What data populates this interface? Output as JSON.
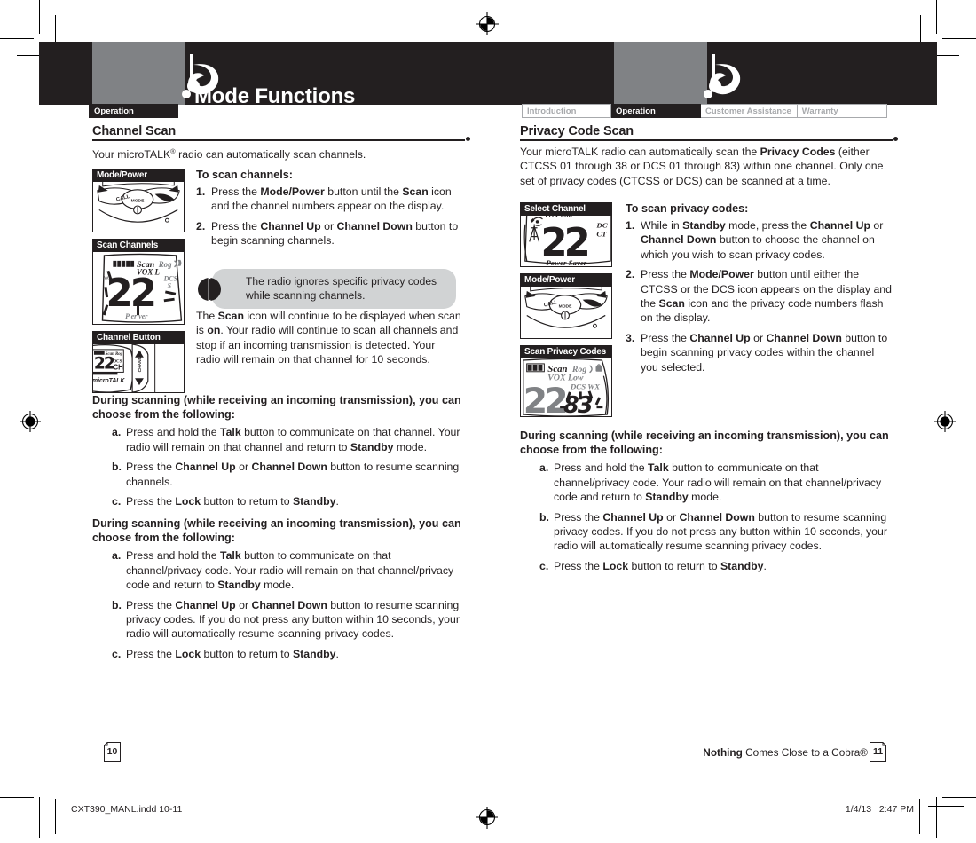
{
  "document": {
    "page_title": "Mode Functions",
    "tabs_left": [
      {
        "label": "Operation",
        "active": true
      }
    ],
    "tabs_right": [
      {
        "label": "Introduction",
        "active": false
      },
      {
        "label": "Operation",
        "active": true
      },
      {
        "label": "Customer Assistance",
        "active": false
      },
      {
        "label": "Warranty",
        "active": false
      }
    ],
    "colors": {
      "ink": "#231f20",
      "header_gray": "#808285",
      "note_gray": "#d1d3d4",
      "tab_inactive": "#a7a9ac"
    }
  },
  "left_page": {
    "page_number": "10",
    "section": {
      "title": "Channel Scan",
      "intro_html": "Your microTALK<sup>®</sup> radio can automatically scan channels."
    },
    "figures": [
      {
        "caption": "Mode/Power",
        "icon": "radio-keypad-photo"
      },
      {
        "caption": "Scan Channels",
        "icon": "lcd-display-scan-channels",
        "lcd": {
          "bars": 5,
          "labels_top": "Scan Rog",
          "labels_sub": "VOX L",
          "digits": "22",
          "labels_right": "DCS",
          "labels_bottom": "Power Saver"
        }
      },
      {
        "caption": "Channel Button",
        "icon": "radio-side-channel-button",
        "lcd": {
          "digits": "22",
          "unit": "CH"
        },
        "side_label": "CHANNEL"
      }
    ],
    "instructions": {
      "heading": "To scan channels:",
      "steps": [
        {
          "num": "1.",
          "html": "Press the <b>Mode/Power</b> button until the <b>Scan</b> icon and the channel numbers appear on the display."
        },
        {
          "num": "2.",
          "html": "Press the <b>Channel Up</b> or <b>Channel Down</b> button to begin scanning channels."
        }
      ]
    },
    "note": {
      "icon": "info-circle-icon",
      "text": "The radio ignores specific privacy codes while scanning channels."
    },
    "body_paragraph_html": "The <b>Scan</b> icon will continue to be displayed when scan is <b>on</b>. Your radio will continue to scan all channels and stop if an incoming transmission is detected. Your radio will remain on that channel for 10 seconds.",
    "blocks": [
      {
        "heading": "During scanning (while receiving an incoming transmission), you can choose from the following:",
        "items": [
          {
            "ltr": "a.",
            "html": "Press and hold the <b>Talk</b> button to communicate on that channel. Your radio will remain on that channel and return to <b>Standby</b> mode."
          },
          {
            "ltr": "b.",
            "html": "Press the <b>Channel Up</b> or <b>Channel Down</b> button to resume scanning channels."
          },
          {
            "ltr": "c.",
            "html": "Press the <b>Lock</b> button to return to <b>Standby</b>."
          }
        ]
      },
      {
        "heading": "During scanning (while receiving an incoming transmission), you can choose from the following:",
        "items": [
          {
            "ltr": "a.",
            "html": "Press and hold the <b>Talk</b> button to communicate on that channel/privacy code. Your radio will remain on that channel/privacy code and return to <b>Standby</b> mode."
          },
          {
            "ltr": "b.",
            "html": "Press the <b>Channel Up</b> or <b>Channel Down</b> button to resume scanning privacy codes. If you do not press any button within 10 seconds, your radio will automatically resume scanning privacy codes."
          },
          {
            "ltr": "c.",
            "html": "Press the <b>Lock</b> button to return to <b>Standby</b>."
          }
        ]
      }
    ]
  },
  "right_page": {
    "page_number": "11",
    "section": {
      "title": "Privacy Code Scan",
      "intro_html": "Your microTALK radio can automatically scan the <b>Privacy Codes</b> (either CTCSS 01 through 38 or DCS 01 through 83) within one channel. Only one set of privacy codes (CTCSS or DCS) can be scanned at a time."
    },
    "figures": [
      {
        "caption": "Select Channel",
        "icon": "lcd-display-select-channel",
        "lcd": {
          "digits": "22",
          "labels_right_top": "DCS",
          "labels_right_bottom": "CTCSS",
          "labels_bottom": "Power Saver"
        }
      },
      {
        "caption": "Mode/Power",
        "icon": "radio-keypad-photo"
      },
      {
        "caption": "Scan Privacy Codes",
        "icon": "lcd-display-scan-privacy-codes",
        "lcd": {
          "bars": 3,
          "labels_top": "Scan Rog",
          "labels_sub": "VOX Low",
          "digits": "22",
          "code": "83",
          "labels_right": "DCS WX"
        }
      }
    ],
    "instructions": {
      "heading": "To scan privacy codes:",
      "steps": [
        {
          "num": "1.",
          "html": "While in <b>Standby</b> mode, press the <b>Channel Up</b> or <b>Channel Down</b> button to choose the channel on which you wish to scan privacy codes."
        },
        {
          "num": "2.",
          "html": "Press the <b>Mode/Power</b> button until either the CTCSS or the DCS icon appears on the display and the <b>Scan</b> icon and the privacy code numbers flash on the display."
        },
        {
          "num": "3.",
          "html": "Press the <b>Channel Up</b> or <b>Channel Down</b> button to begin scanning privacy codes within the channel you selected."
        }
      ]
    },
    "blocks": [
      {
        "heading": "During scanning (while receiving an incoming transmission), you can choose from the following:",
        "items": [
          {
            "ltr": "a.",
            "html": "Press and hold the <b>Talk</b> button to communicate on that channel/privacy code. Your radio will remain on that channel/privacy code and return to <b>Standby</b> mode."
          },
          {
            "ltr": "b.",
            "html": "Press the <b>Channel Up</b> or <b>Channel Down</b> button to resume scanning privacy codes. If you do not press any button within 10 seconds, your radio will automatically resume scanning privacy codes."
          },
          {
            "ltr": "c.",
            "html": "Press the <b>Lock</b> button to return to <b>Standby</b>."
          }
        ]
      }
    ]
  },
  "footer": {
    "tagline_bold": "Nothing",
    "tagline_rest": " Comes Close to a Cobra®",
    "print_file": "CXT390_MANL.indd   10-11",
    "print_date": "1/4/13",
    "print_time": "2:47 PM"
  }
}
